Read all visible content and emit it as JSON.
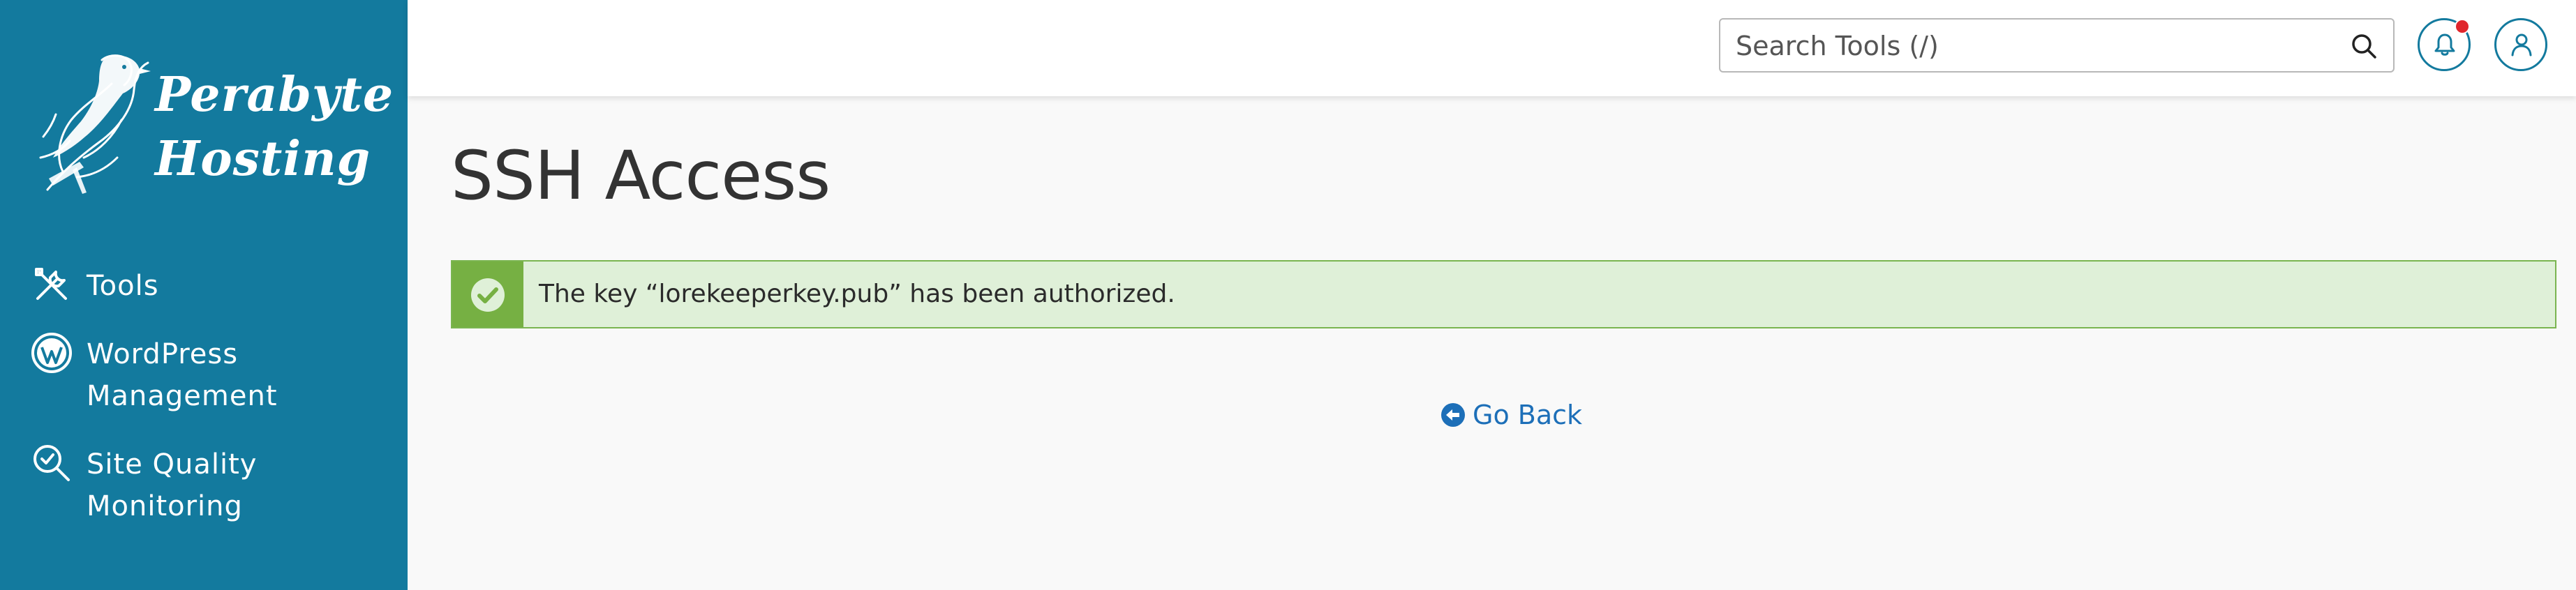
{
  "brand": {
    "line1": "Perabyte",
    "line2": "Hosting"
  },
  "sidebar": {
    "items": [
      {
        "label": "Tools",
        "icon": "tools-icon"
      },
      {
        "label": "WordPress Management",
        "icon": "wordpress-icon"
      },
      {
        "label": "Site Quality Monitoring",
        "icon": "site-quality-icon"
      }
    ]
  },
  "header": {
    "search_placeholder": "Search Tools (/)",
    "icons": [
      "search-icon",
      "bell-icon",
      "user-icon"
    ]
  },
  "main": {
    "title": "SSH Access",
    "alert": {
      "message": "The key “lorekeeperkey.pub” has been authorized.",
      "icon": "check-circle-icon"
    },
    "go_back_label": "Go Back"
  },
  "colors": {
    "sidebar": "#137a9e",
    "alert_bg": "#dff0d8",
    "alert_icon_bg": "#76b043",
    "link": "#1d6fb8",
    "notification_dot": "#e0262c"
  }
}
